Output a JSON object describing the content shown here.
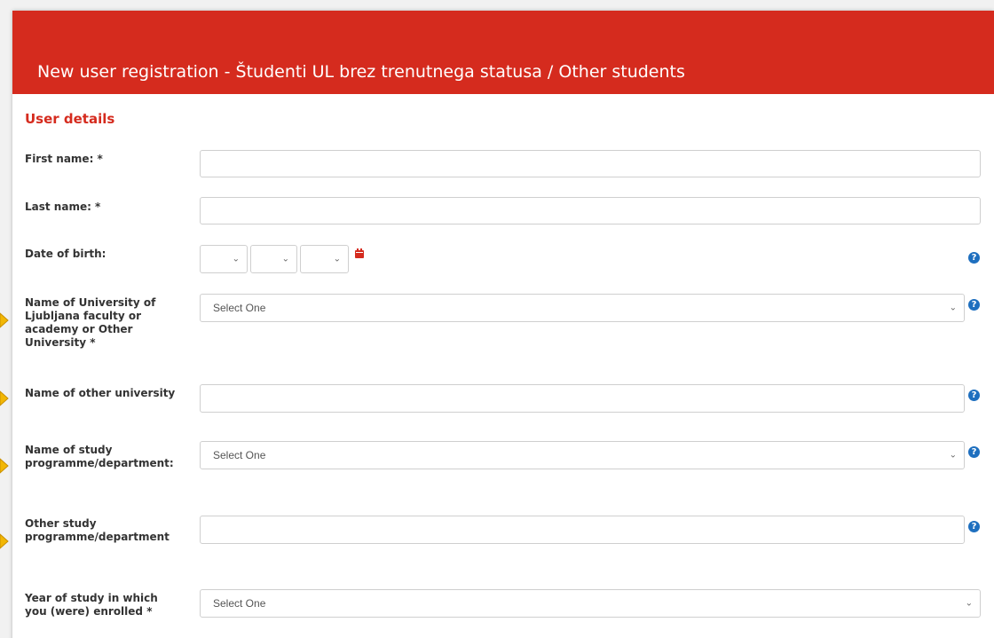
{
  "header": {
    "title": "New user registration - Študenti UL brez trenutnega statusa / Other students"
  },
  "section": {
    "title": "User details"
  },
  "fields": {
    "first_name_label": "First name: *",
    "last_name_label": "Last name: *",
    "dob_label": "Date of birth:",
    "university_label": "Name of University of Ljubljana faculty or academy or Other University *",
    "university_value": "Select One",
    "other_university_label": "Name of other university",
    "study_programme_label": "Name of study programme/department:",
    "study_programme_value": "Select One",
    "other_programme_label": "Other study programme/department",
    "year_label": "Year of study in which you (were) enrolled *",
    "year_value": "Select One"
  },
  "icons": {
    "help": "question-circle-icon",
    "calendar": "calendar-icon",
    "chevron": "chevron-down-icon"
  },
  "colors": {
    "brand": "#d52b1e",
    "help": "#1e6fbf",
    "arrow": "#f2b705"
  }
}
